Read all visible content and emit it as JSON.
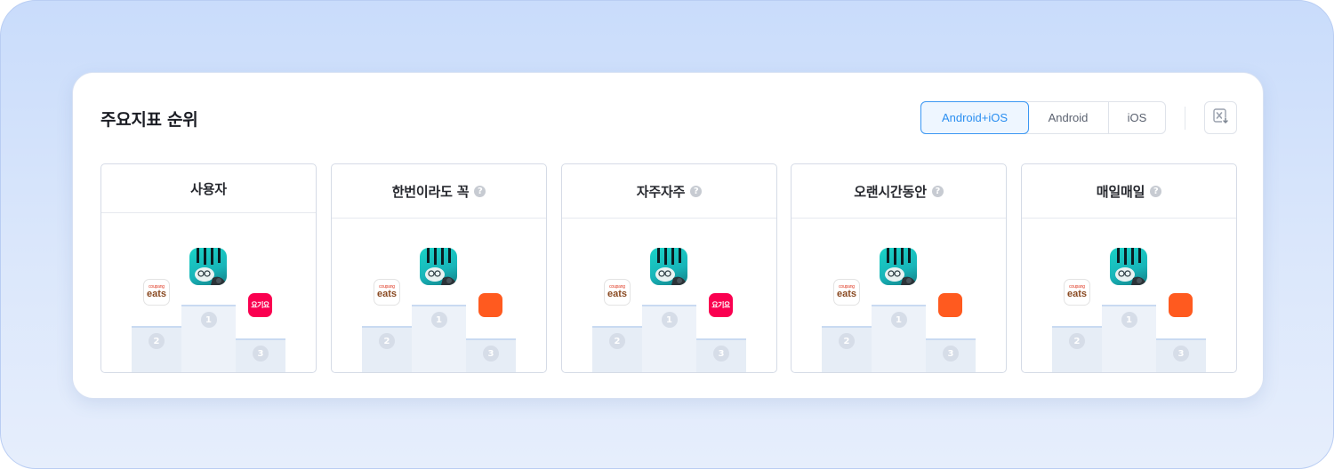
{
  "title": "주요지표 순위",
  "platform_tabs": [
    {
      "label": "Android+iOS",
      "active": true
    },
    {
      "label": "Android",
      "active": false
    },
    {
      "label": "iOS",
      "active": false
    }
  ],
  "export_icon": "excel-download-icon",
  "help_glyph": "?",
  "panels": [
    {
      "title": "사용자",
      "has_help": false,
      "ranks": [
        "1",
        "2",
        "3"
      ],
      "apps": {
        "first": "game-app-icon",
        "second": "coupang-eats-icon",
        "third": "yogiyo-icon"
      },
      "third_color": "#fa0050",
      "third_label": "요기요"
    },
    {
      "title": "한번이라도 꼭",
      "has_help": true,
      "ranks": [
        "1",
        "2",
        "3"
      ],
      "apps": {
        "first": "game-app-icon",
        "second": "coupang-eats-icon",
        "third": "baemin-icon"
      },
      "third_color": "#ff5a1f",
      "third_label": ""
    },
    {
      "title": "자주자주",
      "has_help": true,
      "ranks": [
        "1",
        "2",
        "3"
      ],
      "apps": {
        "first": "game-app-icon",
        "second": "coupang-eats-icon",
        "third": "yogiyo-icon"
      },
      "third_color": "#fa0050",
      "third_label": "요기요"
    },
    {
      "title": "오랜시간동안",
      "has_help": true,
      "ranks": [
        "1",
        "2",
        "3"
      ],
      "apps": {
        "first": "game-app-icon",
        "second": "coupang-eats-icon",
        "third": "baemin-icon"
      },
      "third_color": "#ff5a1f",
      "third_label": ""
    },
    {
      "title": "매일매일",
      "has_help": true,
      "ranks": [
        "1",
        "2",
        "3"
      ],
      "apps": {
        "first": "game-app-icon",
        "second": "coupang-eats-icon",
        "third": "baemin-icon"
      },
      "third_color": "#ff5a1f",
      "third_label": ""
    }
  ],
  "eats_logo": {
    "top": "coupang",
    "main": "eats"
  },
  "colors": {
    "accent": "#2a8ef0",
    "podium": "#e6edf6",
    "yogiyo": "#fa0050",
    "baemin": "#ff5a1f"
  }
}
